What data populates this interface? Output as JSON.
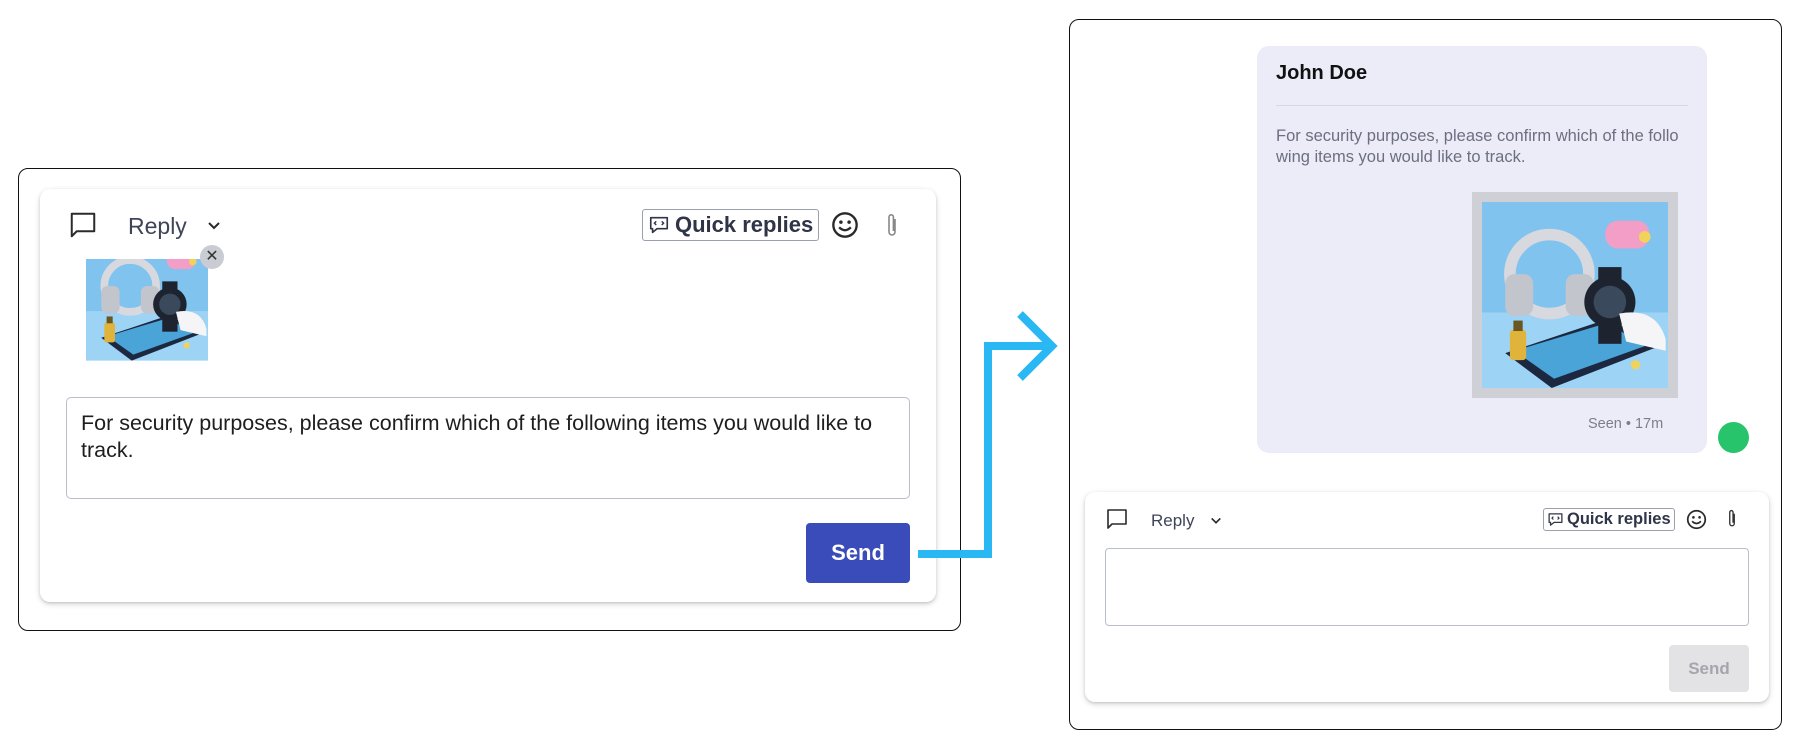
{
  "left_composer": {
    "reply_label": "Reply",
    "quick_replies_label": "Quick replies",
    "attachment": {
      "remove_symbol": "✕"
    },
    "message_text": "For security purposes, please confirm which of the following items you would like to track.",
    "send_label": "Send"
  },
  "conversation": {
    "message": {
      "sender": "John Doe",
      "text": "For security purposes, please confirm which of the following items you would like to track.",
      "status": "Seen • 17m"
    }
  },
  "right_composer": {
    "reply_label": "Reply",
    "quick_replies_label": "Quick replies",
    "message_text": "",
    "send_label": "Send"
  },
  "icons": {
    "chat": "chat-bubble-icon",
    "chevron": "chevron-down-icon",
    "quick_replies": "quick-replies-icon",
    "emoji": "emoji-icon",
    "attach": "paperclip-icon",
    "flow": "flow-arrow-icon"
  },
  "colors": {
    "send_active": "#3a4bba",
    "send_disabled": "#e3e3e5",
    "bubble": "#ececf8",
    "flow_arrow": "#2ab8f5",
    "online_dot": "#27c46b"
  }
}
